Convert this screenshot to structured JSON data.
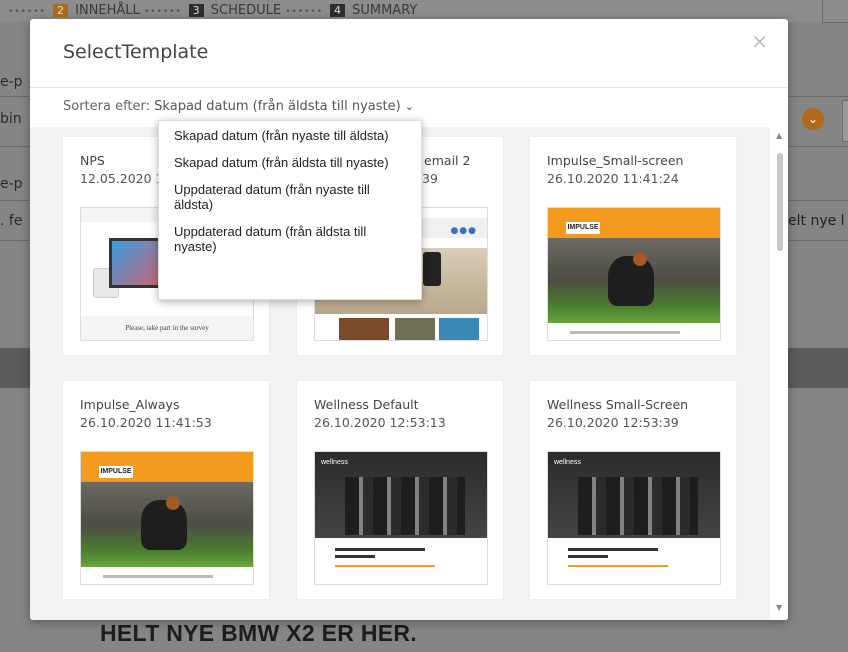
{
  "background": {
    "steps": [
      {
        "num": "2",
        "label": "INNEHÅLL"
      },
      {
        "num": "3",
        "label": "SCHEDULE"
      },
      {
        "num": "4",
        "label": "SUMMARY"
      }
    ],
    "left_fragments": [
      "e-p",
      "bin",
      "e-p",
      ". fe"
    ],
    "right_text": "elt nye l",
    "heading": "HELT NYE BMW X2 ER HER."
  },
  "modal": {
    "title": "SelectTemplate",
    "close_symbol": "×",
    "sort_label": "Sortera efter:",
    "sort_value": "Skapad datum (från äldsta till nyaste)",
    "sort_options": [
      "Skapad datum (från nyaste till äldsta)",
      "Skapad datum (från äldsta till nyaste)",
      "Uppdaterad datum (från nyaste till äldsta)",
      "Uppdaterad datum (från äldsta till nyaste)"
    ],
    "templates": [
      {
        "name": "NPS",
        "date": "12.05.2020 1",
        "thumb_text": "Please, take part in the survey"
      },
      {
        "name": "sive email 2",
        "date": "39"
      },
      {
        "name": "Impulse_Small-screen",
        "date": "26.10.2020 11:41:24",
        "thumb_text": "IMPULSE"
      },
      {
        "name": "Impulse_Always",
        "date": "26.10.2020 11:41:53",
        "thumb_text": "IMPULSE"
      },
      {
        "name": "Wellness Default",
        "date": "26.10.2020 12:53:13",
        "thumb_text": "wellness"
      },
      {
        "name": "Wellness Small-Screen",
        "date": "26.10.2020 12:53:39",
        "thumb_text": "wellness"
      }
    ]
  },
  "colors": {
    "accent_orange": "#f39a1f",
    "link_blue": "#3a6fc4"
  },
  "icons": [
    "close-icon",
    "chevron-down-icon",
    "scroll-up-icon",
    "scroll-down-icon"
  ]
}
